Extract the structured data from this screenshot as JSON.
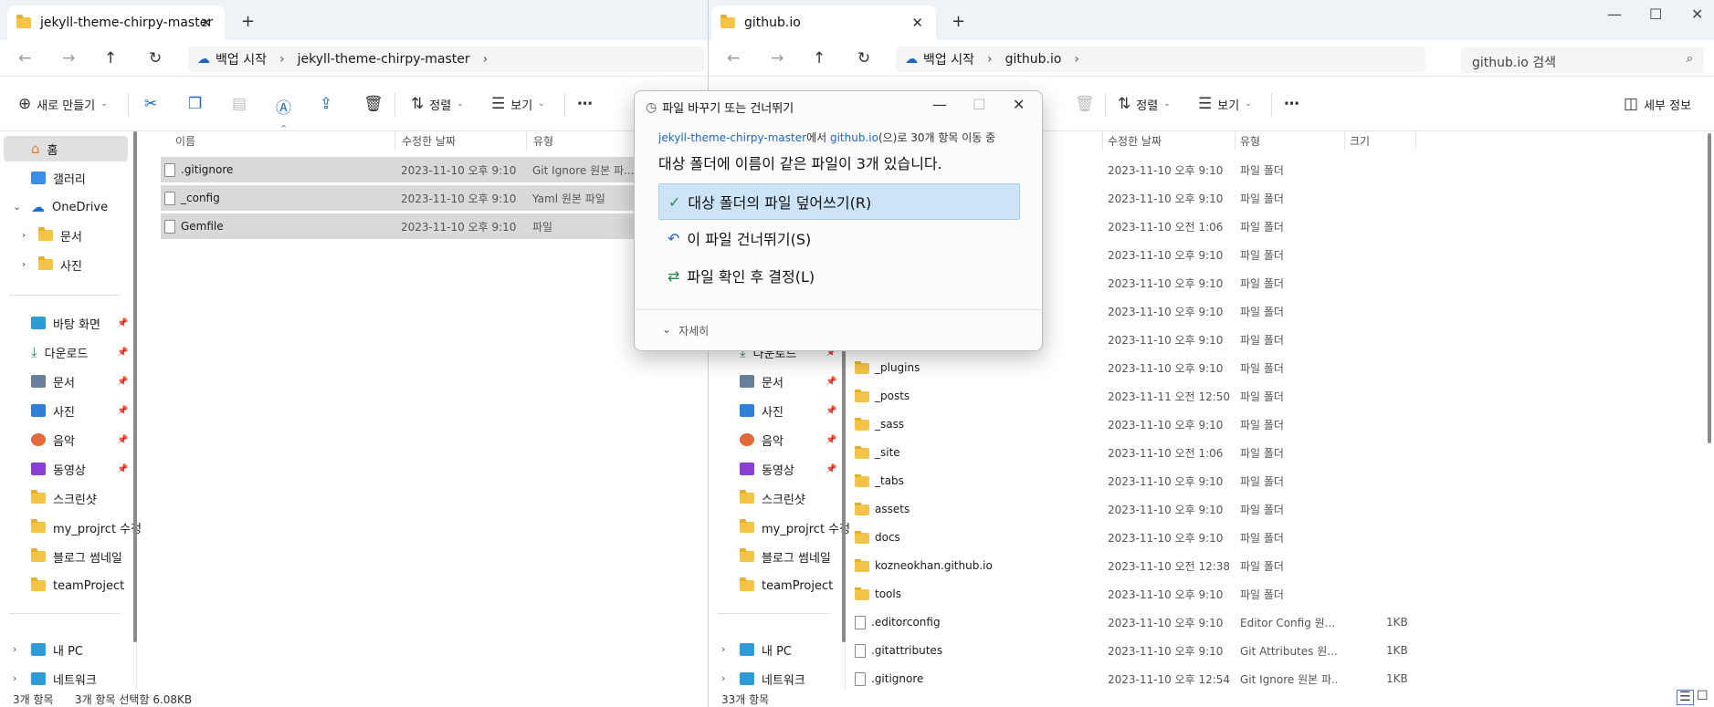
{
  "left_window": {
    "tab_title": "jekyll-theme-chirpy-master",
    "breadcrumb": [
      "백업 시작",
      "jekyll-theme-chirpy-master"
    ],
    "toolbar": {
      "new_label": "새로 만들기",
      "sort_label": "정렬",
      "view_label": "보기"
    },
    "sidebar": {
      "home": "홈",
      "gallery": "갤러리",
      "onedrive": "OneDrive",
      "docs": "문서",
      "photos": "사진",
      "quick": [
        "바탕 화면",
        "다운로드",
        "문서",
        "사진",
        "음악",
        "동영상",
        "스크린샷",
        "my_projrct 수정",
        "블로그 썸네일",
        "teamProject"
      ],
      "pc": "내 PC",
      "network": "네트워크"
    },
    "columns": [
      "이름",
      "수정한 날짜",
      "유형"
    ],
    "files": [
      {
        "name": ".gitignore",
        "date": "2023-11-10 오후 9:10",
        "type": "Git Ignore 원본 파..."
      },
      {
        "name": "_config",
        "date": "2023-11-10 오후 9:10",
        "type": "Yaml 원본 파일"
      },
      {
        "name": "Gemfile",
        "date": "2023-11-10 오후 9:10",
        "type": "파일"
      }
    ],
    "status": {
      "count": "3개 항목",
      "selected": "3개 항목 선택함 6.08KB"
    }
  },
  "right_window": {
    "tab_title": "github.io",
    "breadcrumb": [
      "백업 시작",
      "github.io"
    ],
    "search_placeholder": "github.io 검색",
    "toolbar": {
      "sort_label": "정렬",
      "view_label": "보기",
      "details_label": "세부 정보"
    },
    "sidebar_quick": [
      "다운로드",
      "문서",
      "사진",
      "음악",
      "동영상",
      "스크린샷",
      "my_projrct 수정",
      "블로그 썸네일",
      "teamProject"
    ],
    "sidebar_pc": "내 PC",
    "sidebar_network": "네트워크",
    "columns": [
      "수정한 날짜",
      "유형",
      "크기"
    ],
    "rows_hidden": [
      {
        "date": "2023-11-10 오후 9:10",
        "type": "파일 폴더"
      },
      {
        "date": "2023-11-10 오후 9:10",
        "type": "파일 폴더"
      },
      {
        "date": "2023-11-10 오전 1:06",
        "type": "파일 폴더"
      },
      {
        "date": "2023-11-10 오후 9:10",
        "type": "파일 폴더"
      },
      {
        "date": "2023-11-10 오후 9:10",
        "type": "파일 폴더"
      },
      {
        "date": "2023-11-10 오후 9:10",
        "type": "파일 폴더"
      },
      {
        "date": "2023-11-10 오후 9:10",
        "type": "파일 폴더"
      }
    ],
    "rows": [
      {
        "name": "_plugins",
        "date": "2023-11-10 오후 9:10",
        "type": "파일 폴더",
        "size": "",
        "kind": "folder"
      },
      {
        "name": "_posts",
        "date": "2023-11-11 오전 12:50",
        "type": "파일 폴더",
        "size": "",
        "kind": "folder"
      },
      {
        "name": "_sass",
        "date": "2023-11-10 오후 9:10",
        "type": "파일 폴더",
        "size": "",
        "kind": "folder"
      },
      {
        "name": "_site",
        "date": "2023-11-10 오전 1:06",
        "type": "파일 폴더",
        "size": "",
        "kind": "folder"
      },
      {
        "name": "_tabs",
        "date": "2023-11-10 오후 9:10",
        "type": "파일 폴더",
        "size": "",
        "kind": "folder"
      },
      {
        "name": "assets",
        "date": "2023-11-10 오후 9:10",
        "type": "파일 폴더",
        "size": "",
        "kind": "folder"
      },
      {
        "name": "docs",
        "date": "2023-11-10 오후 9:10",
        "type": "파일 폴더",
        "size": "",
        "kind": "folder"
      },
      {
        "name": "kozneokhan.github.io",
        "date": "2023-11-10 오전 12:38",
        "type": "파일 폴더",
        "size": "",
        "kind": "folder"
      },
      {
        "name": "tools",
        "date": "2023-11-10 오후 9:10",
        "type": "파일 폴더",
        "size": "",
        "kind": "folder"
      },
      {
        "name": ".editorconfig",
        "date": "2023-11-10 오후 9:10",
        "type": "Editor Config 원...",
        "size": "1KB",
        "kind": "file"
      },
      {
        "name": ".gitattributes",
        "date": "2023-11-10 오후 9:10",
        "type": "Git Attributes 원...",
        "size": "1KB",
        "kind": "file"
      },
      {
        "name": ".gitignore",
        "date": "2023-11-10 오후 12:54",
        "type": "Git Ignore 원본 파...",
        "size": "1KB",
        "kind": "file"
      }
    ],
    "status": {
      "count": "33개 항목"
    }
  },
  "dialog": {
    "title": "파일 바꾸기 또는 건너뛰기",
    "source": "jekyll-theme-chirpy-master",
    "from_word": "에서 ",
    "dest": "github.io",
    "move_text": "(으)로 30개 항목 이동 중",
    "message": "대상 폴더에 이름이 같은 파일이 3개 있습니다.",
    "options": [
      "대상 폴더의 파일 덮어쓰기(R)",
      "이 파일 건너뛰기(S)",
      "파일 확인 후 결정(L)"
    ],
    "details": "자세히"
  }
}
